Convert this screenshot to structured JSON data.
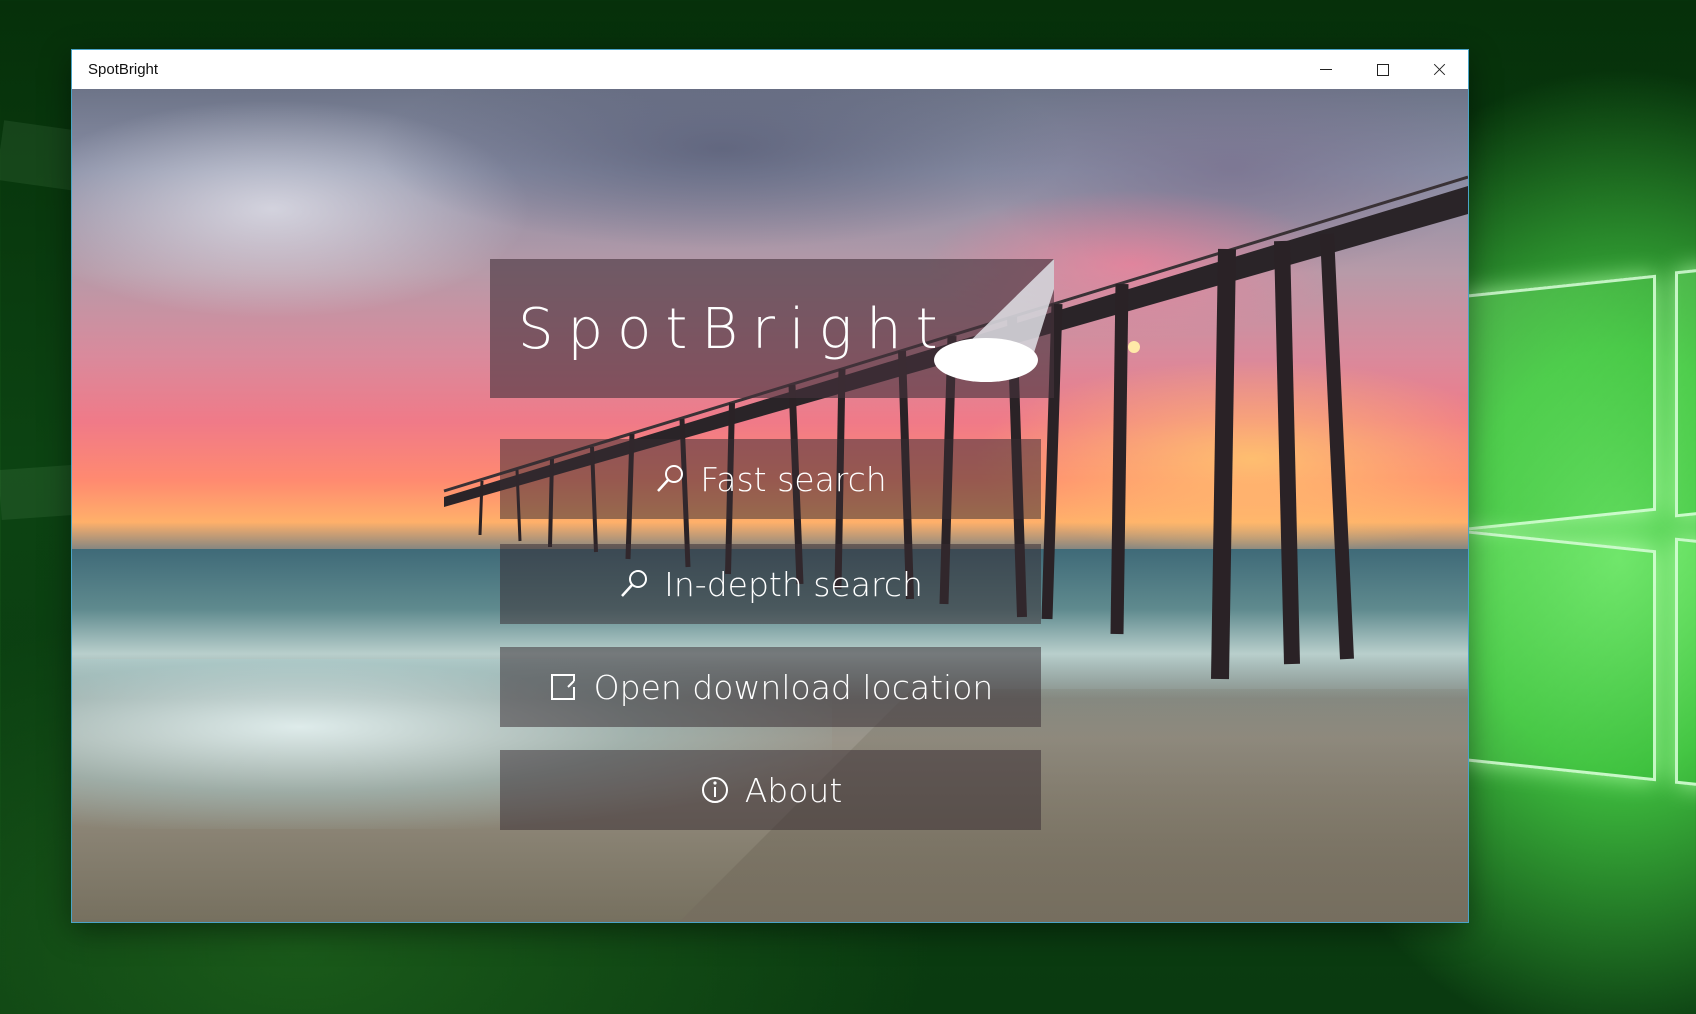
{
  "window": {
    "title": "SpotBright"
  },
  "caption_buttons": {
    "minimize": "minimize-icon",
    "maximize": "maximize-icon",
    "close": "close-icon"
  },
  "app": {
    "logo_text": "SpotBright",
    "logo_icon": "spotlight-icon"
  },
  "menu": [
    {
      "label": "Fast search",
      "icon": "search-icon"
    },
    {
      "label": "In-depth search",
      "icon": "search-icon"
    },
    {
      "label": "Open download location",
      "icon": "folder-open-icon"
    },
    {
      "label": "About",
      "icon": "info-icon"
    }
  ],
  "colors": {
    "desktop_green": "#0c4312",
    "window_border": "#4aa3c8",
    "panel_overlay": "#46323c"
  }
}
